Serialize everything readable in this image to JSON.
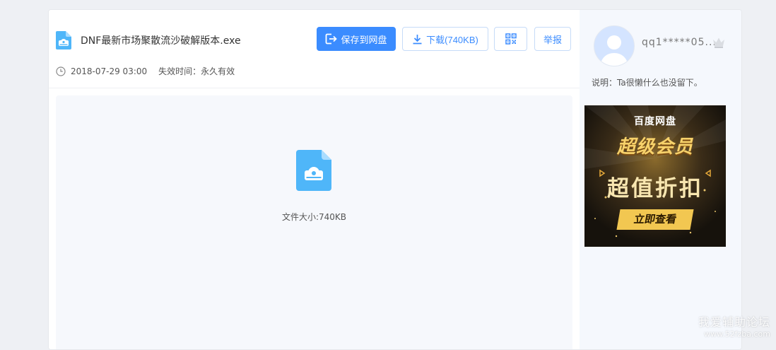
{
  "file": {
    "name": "DNF最新市场聚散流沙破解版本.exe",
    "date": "2018-07-29 03:00",
    "expiry": "失效时间：永久有效",
    "size_text": "文件大小:740KB"
  },
  "toolbar": {
    "save_label": "保存到网盘",
    "download_label": "下载(740KB)",
    "report_label": "举报"
  },
  "user": {
    "name": "qq1*****05...",
    "description": "说明：Ta很懒什么也没留下。"
  },
  "ad": {
    "brand": "百度网盘",
    "title": "超级会员",
    "discount": "超值折扣",
    "cta": "立即查看"
  },
  "watermark": {
    "line1": "我爱辅助论坛",
    "line2": "www.52fzba.com"
  },
  "icons": {
    "file": "file-disc-icon",
    "clock": "clock-icon",
    "save": "save-to-disk-icon",
    "download": "download-icon",
    "qrcode": "qrcode-icon",
    "crown": "crown-icon",
    "avatar": "user-avatar-icon"
  },
  "colors": {
    "primary": "#3b8cff",
    "file_icon": "#4fb6f9",
    "right_panel_bg": "#f5f8fd",
    "preview_bg": "#f6f8fc"
  }
}
